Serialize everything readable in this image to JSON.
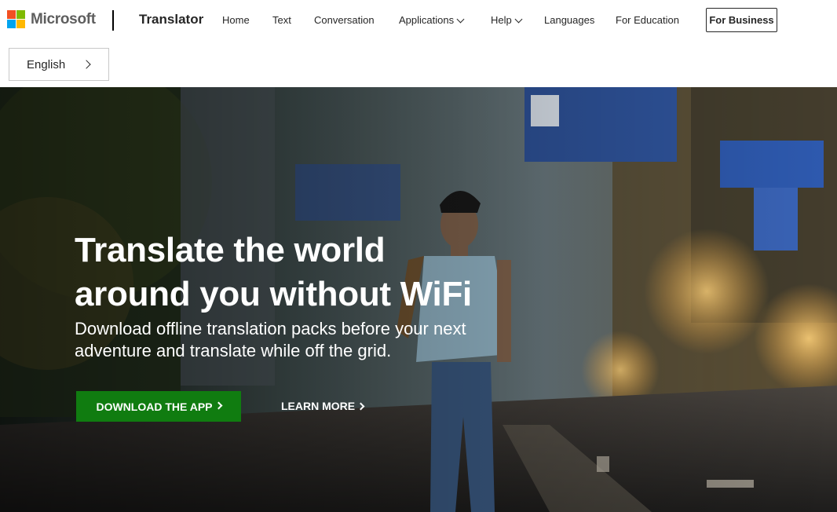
{
  "header": {
    "brand": "Microsoft",
    "product": "Translator",
    "nav": [
      {
        "label": "Home"
      },
      {
        "label": "Text"
      },
      {
        "label": "Conversation"
      },
      {
        "label": "Applications"
      },
      {
        "label": "Help"
      },
      {
        "label": "Languages"
      },
      {
        "label": "For Education"
      }
    ],
    "business_button": "For Business"
  },
  "language_selector": {
    "label": "English"
  },
  "hero": {
    "title_line1": "Translate the world",
    "title_line2": "around you without WiFi",
    "subtitle_line1": "Download offline translation packs before your next",
    "subtitle_line2": "adventure and translate while off the grid.",
    "primary_cta": "DOWNLOAD THE APP",
    "secondary_cta": "LEARN MORE"
  },
  "colors": {
    "ms_red": "#f25022",
    "ms_green": "#7fba00",
    "ms_blue": "#00a4ef",
    "ms_yellow": "#ffb900",
    "cta_green": "#107c10"
  }
}
